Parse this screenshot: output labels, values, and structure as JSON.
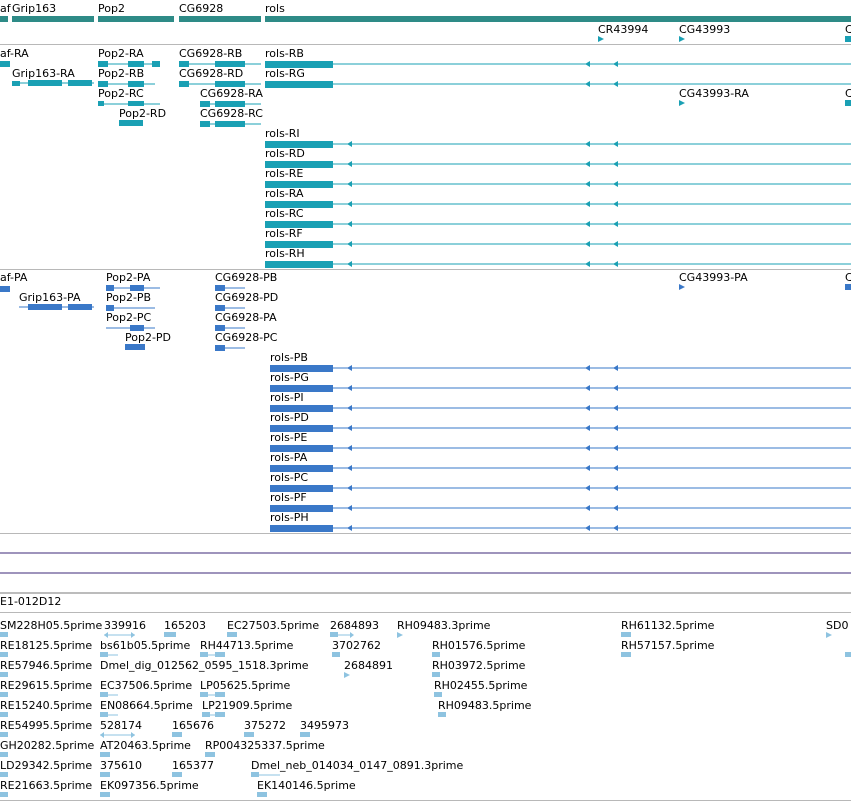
{
  "colors": {
    "gene": "#2e8b87",
    "txA": "#1aa0b4",
    "txB": "#3a78c8",
    "est": "#8ec3e0",
    "purple": "#3d2a7a"
  },
  "genes": [
    "af",
    "Grip163",
    "Pop2",
    "CG6928",
    "rols",
    "CR43994",
    "CG43993",
    "C"
  ],
  "rna": [
    "af-RA",
    "Grip163-RA",
    "Pop2-RA",
    "Pop2-RB",
    "Pop2-RC",
    "Pop2-RD",
    "CG6928-RB",
    "CG6928-RD",
    "CG6928-RA",
    "CG6928-RC",
    "rols-RB",
    "rols-RG",
    "CG43993-RA",
    "C",
    "rols-RI",
    "rols-RD",
    "rols-RE",
    "rols-RA",
    "rols-RC",
    "rols-RF",
    "rols-RH"
  ],
  "prot": [
    "af-PA",
    "Grip163-PA",
    "Pop2-PA",
    "Pop2-PB",
    "Pop2-PC",
    "Pop2-PD",
    "CG6928-PB",
    "CG6928-PD",
    "CG6928-PA",
    "CG6928-PC",
    "CG43993-PA",
    "C",
    "rols-PB",
    "rols-PG",
    "rols-PI",
    "rols-PD",
    "rols-PE",
    "rols-PA",
    "rols-PC",
    "rols-PF",
    "rols-PH"
  ],
  "clone": "E1-012D12",
  "est": [
    "SM228H05.5prime",
    "339916",
    "165203",
    "EC27503.5prime",
    "2684893",
    "RH09483.3prime",
    "RH61132.5prime",
    "SD0",
    "RE18125.5prime",
    "bs61b05.5prime",
    "RH44713.5prime",
    "3702762",
    "RH01576.5prime",
    "RH57157.5prime",
    "RE57946.5prime",
    "Dmel_dig_012562_0595_1518.3prime",
    "2684891",
    "RH03972.5prime",
    "RE29615.5prime",
    "EC37506.5prime",
    "LP05625.5prime",
    "RH02455.5prime",
    "RE15240.5prime",
    "EN08664.5prime",
    "LP21909.5prime",
    "RH09483.5prime",
    "RE54995.5prime",
    "528174",
    "165676",
    "375272",
    "3495973",
    "GH20282.5prime",
    "AT20463.5prime",
    "RP004325337.5prime",
    "LD29342.5prime",
    "375610",
    "165377",
    "Dmel_neb_014034_0147_0891.3prime",
    "RE21663.5prime",
    "EK097356.5prime",
    "EK140146.5prime"
  ]
}
